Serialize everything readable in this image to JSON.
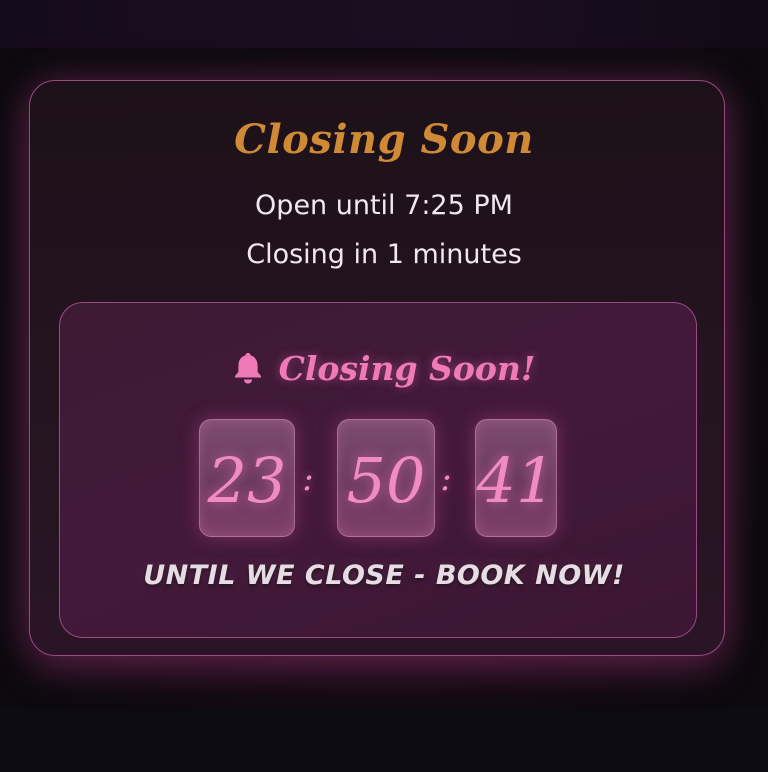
{
  "widget": {
    "title": "Closing Soon",
    "open_until": "Open until 7:25 PM",
    "closing_in": "Closing in 1 minutes"
  },
  "countdown": {
    "alert_icon": "bell-icon",
    "alert_label": "Closing Soon!",
    "hours": "23",
    "minutes": "50",
    "seconds": "41",
    "separator": ":",
    "cta": "UNTIL WE CLOSE - BOOK NOW!"
  },
  "colors": {
    "title": "#d08a36",
    "accent_pink": "#f07ab8",
    "border": "#9a4a80",
    "background": "#0c0a0e"
  }
}
